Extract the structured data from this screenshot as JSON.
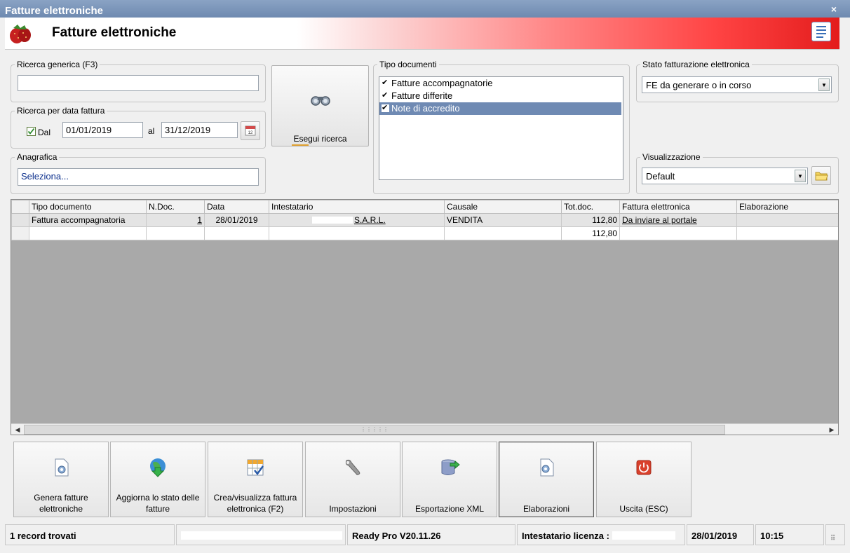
{
  "window": {
    "title": "Fatture elettroniche",
    "close_glyph": "×"
  },
  "header": {
    "title": "Fatture elettroniche",
    "app_icon": "strawberry-icon",
    "list_icon": "list-view-icon"
  },
  "search_generic": {
    "legend": "Ricerca generica (F3)",
    "value": ""
  },
  "search_date": {
    "legend": "Ricerca per data fattura",
    "checkbox_label": "Dal",
    "checked": true,
    "from": "01/01/2019",
    "to_label": "al",
    "to": "31/12/2019"
  },
  "anagrafica": {
    "legend": "Anagrafica",
    "value": "Seleziona..."
  },
  "search_button": {
    "label": "Esegui ricerca",
    "icon": "binoculars-icon"
  },
  "tipo_documenti": {
    "legend": "Tipo documenti",
    "items": [
      {
        "label": "Fatture accompagnatorie",
        "checked": true,
        "selected": false
      },
      {
        "label": "Fatture differite",
        "checked": true,
        "selected": false
      },
      {
        "label": "Note di accredito",
        "checked": true,
        "selected": true
      }
    ]
  },
  "stato_fe": {
    "legend": "Stato fatturazione elettronica",
    "value": "FE da generare o in corso"
  },
  "visualizzazione": {
    "legend": "Visualizzazione",
    "value": "Default"
  },
  "grid": {
    "columns": [
      "",
      "Tipo documento",
      "N.Doc.",
      "Data",
      "Intestatario",
      "Causale",
      "Tot.doc.",
      "Fattura elettronica",
      "Elaborazione"
    ],
    "rows": [
      {
        "tipo": "Fattura accompagnatoria",
        "ndoc": "1",
        "data": "28/01/2019",
        "intestatario": "S.A.R.L.",
        "causale": "VENDITA",
        "tot": "112,80",
        "fe": "Da inviare al portale",
        "elab": ""
      }
    ],
    "totals": {
      "tot": "112,80"
    }
  },
  "toolbar": [
    {
      "name": "genera-fatture-button",
      "label": "Genera fatture elettroniche",
      "icon": "document-gear-icon",
      "active": false
    },
    {
      "name": "aggiorna-stato-button",
      "label": "Aggiorna lo stato delle fatture",
      "icon": "globe-download-icon",
      "active": false
    },
    {
      "name": "crea-visualizza-button",
      "label": "Crea/visualizza fattura elettronica (F2)",
      "icon": "table-check-icon",
      "active": false
    },
    {
      "name": "impostazioni-button",
      "label": "Impostazioni",
      "icon": "wrench-icon",
      "active": false
    },
    {
      "name": "esportazione-xml-button",
      "label": "Esportazione XML",
      "icon": "database-export-icon",
      "active": false
    },
    {
      "name": "elaborazioni-button",
      "label": "Elaborazioni",
      "icon": "document-gear-icon",
      "active": true
    },
    {
      "name": "uscita-button",
      "label": "Uscita (ESC)",
      "icon": "power-icon",
      "active": false
    }
  ],
  "status": {
    "records": "1 record trovati",
    "version": "Ready Pro V20.11.26",
    "license": "Intestatario licenza :",
    "date": "28/01/2019",
    "time": "10:15"
  },
  "colors": {
    "title_bar": "#7891b6",
    "banner_red": "#e31c1c",
    "selection": "#6f8ab3",
    "grid_bg": "#a9a9a9"
  }
}
